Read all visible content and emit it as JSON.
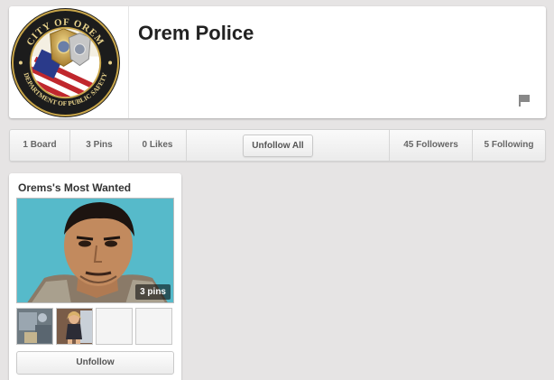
{
  "profile": {
    "name": "Orem Police",
    "seal_text_top": "CITY OF OREM",
    "seal_text_bottom": "DEPARTMENT OF PUBLIC SAFETY"
  },
  "stats_bar": {
    "boards": "1 Board",
    "pins": "3 Pins",
    "likes": "0 Likes",
    "unfollow_all_label": "Unfollow All",
    "followers": "45 Followers",
    "following": "5 Following"
  },
  "board": {
    "title": "Orems's Most Wanted",
    "pin_count": "3 pins",
    "unfollow_label": "Unfollow"
  },
  "icons": {
    "flag": "flag-icon"
  },
  "colors": {
    "background": "#e6e4e4",
    "card": "#ffffff",
    "text": "#333333"
  }
}
